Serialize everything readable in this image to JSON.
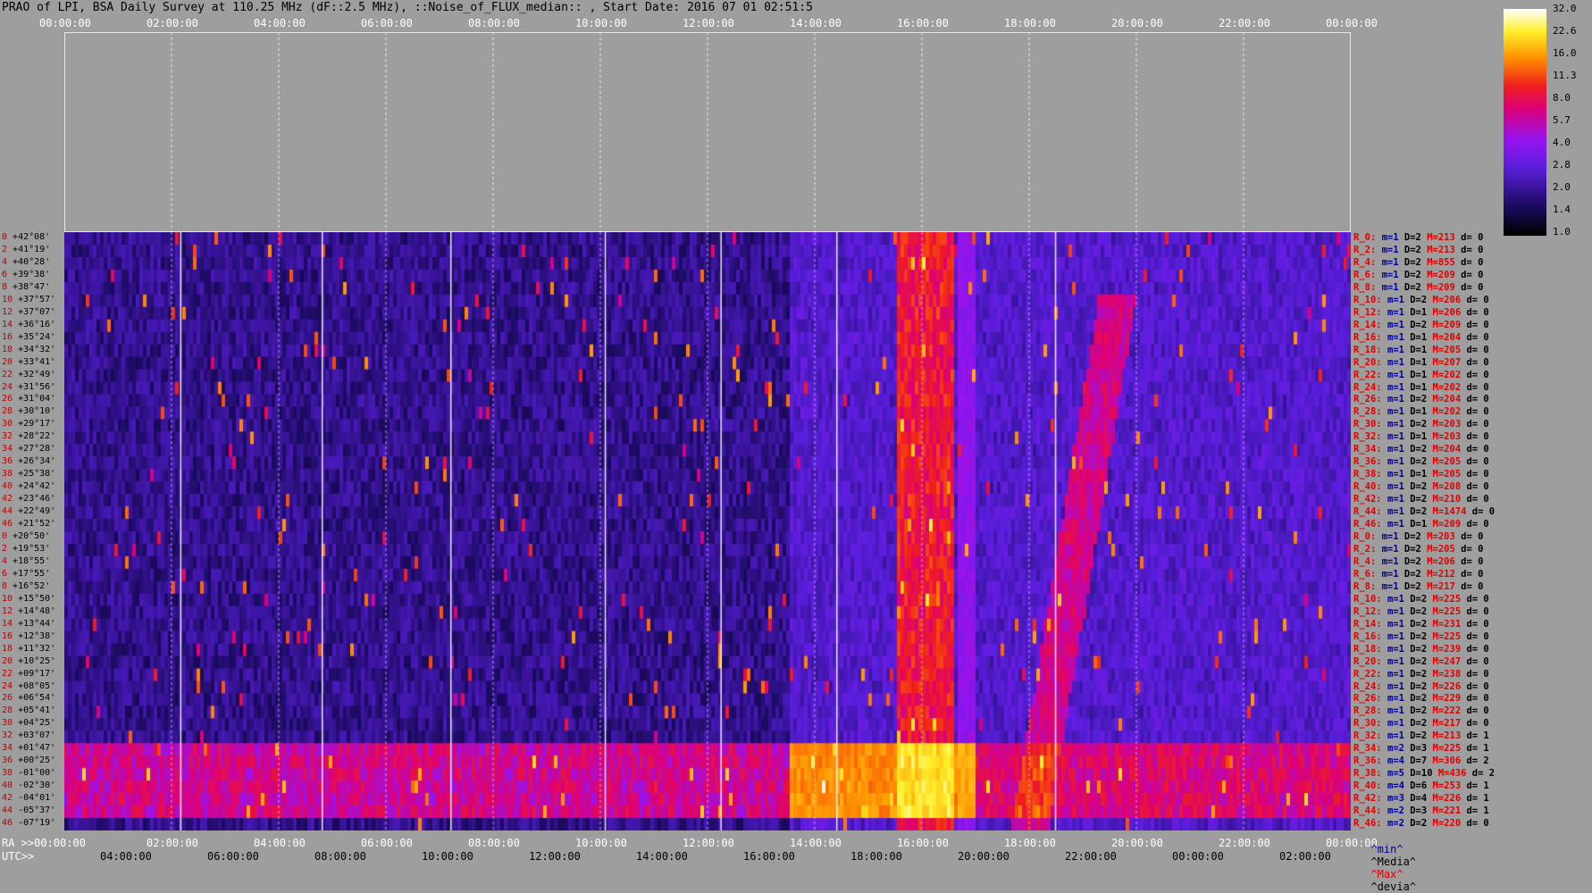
{
  "title": "PRAO of LPI, BSA Daily Survey at 110.25 MHz (dF::2.5 MHz), ::Noise_of_FLUX_median:: , Start Date: 2016 07 01 02:51:5",
  "axis": {
    "top_ticks": [
      "00:00:00",
      "02:00:00",
      "04:00:00",
      "06:00:00",
      "08:00:00",
      "10:00:00",
      "12:00:00",
      "14:00:00",
      "16:00:00",
      "18:00:00",
      "20:00:00",
      "22:00:00",
      "00:00:00"
    ],
    "ra_label": "RA >>00:00:00",
    "ra_ticks": [
      "02:00:00",
      "04:00:00",
      "06:00:00",
      "08:00:00",
      "10:00:00",
      "12:00:00",
      "14:00:00",
      "16:00:00",
      "18:00:00",
      "20:00:00",
      "22:00:00",
      "00:00:00"
    ],
    "utc_label": "UTC>>",
    "utc_ticks": [
      "04:00:00",
      "06:00:00",
      "08:00:00",
      "10:00:00",
      "12:00:00",
      "14:00:00",
      "16:00:00",
      "18:00:00",
      "20:00:00",
      "22:00:00",
      "00:00:00",
      "02:00:00"
    ]
  },
  "colorbar": {
    "ticks": [
      "32.0",
      "22.6",
      "16.0",
      "11.3",
      "8.0",
      "5.7",
      "4.0",
      "2.8",
      "2.0",
      "1.4",
      "1.0"
    ]
  },
  "legend": {
    "min": "^min^",
    "media": "^Media^",
    "max": "^Max^",
    "devia": "^devia^"
  },
  "chart_data": {
    "type": "heatmap",
    "title": "PRAO of LPI, BSA Daily Survey at 110.25 MHz (dF::2.5 MHz), ::Noise_of_FLUX_median:: , Start Date: 2016 07 01 02:51:5",
    "xlabel": "RA / UTC",
    "x_range_hours": [
      0,
      24
    ],
    "colorscale_range": [
      1.0,
      32.0
    ],
    "colorscale_log": true,
    "grid": true,
    "declinations": [
      "+42°08'",
      "+41°19'",
      "+40°28'",
      "+39°38'",
      "+38°47'",
      "+37°57'",
      "+37°07'",
      "+36°16'",
      "+35°24'",
      "+34°32'",
      "+33°41'",
      "+32°49'",
      "+31°56'",
      "+31°04'",
      "+30°10'",
      "+29°17'",
      "+28°22'",
      "+27°28'",
      "+26°34'",
      "+25°38'",
      "+24°42'",
      "+23°46'",
      "+22°49'",
      "+21°52'",
      "+20°50'",
      "+19°53'",
      "+18°55'",
      "+17°55'",
      "+16°52'",
      "+15°50'",
      "+14°48'",
      "+13°44'",
      "+12°38'",
      "+11°32'",
      "+10°25'",
      "+09°17'",
      "+08°05'",
      "+06°54'",
      "+05°41'",
      "+04°25'",
      "+03°07'",
      "+01°47'",
      "+00°25'",
      "-01°00'",
      "-02°30'",
      "-04°01'",
      "-05°37'",
      "-07°19'"
    ],
    "row_indices": [
      "0",
      "2",
      "4",
      "6",
      "8",
      "10",
      "12",
      "14",
      "16",
      "18",
      "20",
      "22",
      "24",
      "26",
      "28",
      "30",
      "32",
      "34",
      "36",
      "38",
      "40",
      "42",
      "44",
      "46",
      "0",
      "2",
      "4",
      "6",
      "8",
      "10",
      "12",
      "14",
      "16",
      "18",
      "20",
      "22",
      "24",
      "26",
      "28",
      "30",
      "32",
      "34",
      "36",
      "38",
      "40",
      "42",
      "44",
      "46"
    ],
    "row_stats": [
      {
        "r": "R_0:",
        "m": "m=1",
        "D": "D=2",
        "M": "M=213",
        "d": "d= 0"
      },
      {
        "r": "R_2:",
        "m": "m=1",
        "D": "D=2",
        "M": "M=213",
        "d": "d= 0"
      },
      {
        "r": "R_4:",
        "m": "m=1",
        "D": "D=2",
        "M": "M=855",
        "d": "d= 0"
      },
      {
        "r": "R_6:",
        "m": "m=1",
        "D": "D=2",
        "M": "M=209",
        "d": "d= 0"
      },
      {
        "r": "R_8:",
        "m": "m=1",
        "D": "D=2",
        "M": "M=209",
        "d": "d= 0"
      },
      {
        "r": "R_10:",
        "m": "m=1",
        "D": "D=2",
        "M": "M=206",
        "d": "d= 0"
      },
      {
        "r": "R_12:",
        "m": "m=1",
        "D": "D=1",
        "M": "M=206",
        "d": "d= 0"
      },
      {
        "r": "R_14:",
        "m": "m=1",
        "D": "D=2",
        "M": "M=209",
        "d": "d= 0"
      },
      {
        "r": "R_16:",
        "m": "m=1",
        "D": "D=1",
        "M": "M=204",
        "d": "d= 0"
      },
      {
        "r": "R_18:",
        "m": "m=1",
        "D": "D=1",
        "M": "M=205",
        "d": "d= 0"
      },
      {
        "r": "R_20:",
        "m": "m=1",
        "D": "D=1",
        "M": "M=207",
        "d": "d= 0"
      },
      {
        "r": "R_22:",
        "m": "m=1",
        "D": "D=1",
        "M": "M=202",
        "d": "d= 0"
      },
      {
        "r": "R_24:",
        "m": "m=1",
        "D": "D=1",
        "M": "M=202",
        "d": "d= 0"
      },
      {
        "r": "R_26:",
        "m": "m=1",
        "D": "D=2",
        "M": "M=204",
        "d": "d= 0"
      },
      {
        "r": "R_28:",
        "m": "m=1",
        "D": "D=1",
        "M": "M=202",
        "d": "d= 0"
      },
      {
        "r": "R_30:",
        "m": "m=1",
        "D": "D=2",
        "M": "M=203",
        "d": "d= 0"
      },
      {
        "r": "R_32:",
        "m": "m=1",
        "D": "D=1",
        "M": "M=203",
        "d": "d= 0"
      },
      {
        "r": "R_34:",
        "m": "m=1",
        "D": "D=2",
        "M": "M=204",
        "d": "d= 0"
      },
      {
        "r": "R_36:",
        "m": "m=1",
        "D": "D=2",
        "M": "M=205",
        "d": "d= 0"
      },
      {
        "r": "R_38:",
        "m": "m=1",
        "D": "D=1",
        "M": "M=205",
        "d": "d= 0"
      },
      {
        "r": "R_40:",
        "m": "m=1",
        "D": "D=2",
        "M": "M=208",
        "d": "d= 0"
      },
      {
        "r": "R_42:",
        "m": "m=1",
        "D": "D=2",
        "M": "M=210",
        "d": "d= 0"
      },
      {
        "r": "R_44:",
        "m": "m=1",
        "D": "D=2",
        "M": "M=1474",
        "d": "d= 0"
      },
      {
        "r": "R_46:",
        "m": "m=1",
        "D": "D=1",
        "M": "M=209",
        "d": "d= 0"
      },
      {
        "r": "R_0:",
        "m": "m=1",
        "D": "D=2",
        "M": "M=203",
        "d": "d= 0"
      },
      {
        "r": "R_2:",
        "m": "m=1",
        "D": "D=2",
        "M": "M=205",
        "d": "d= 0"
      },
      {
        "r": "R_4:",
        "m": "m=1",
        "D": "D=2",
        "M": "M=206",
        "d": "d= 0"
      },
      {
        "r": "R_6:",
        "m": "m=1",
        "D": "D=2",
        "M": "M=212",
        "d": "d= 0"
      },
      {
        "r": "R_8:",
        "m": "m=1",
        "D": "D=2",
        "M": "M=217",
        "d": "d= 0"
      },
      {
        "r": "R_10:",
        "m": "m=1",
        "D": "D=2",
        "M": "M=225",
        "d": "d= 0"
      },
      {
        "r": "R_12:",
        "m": "m=1",
        "D": "D=2",
        "M": "M=225",
        "d": "d= 0"
      },
      {
        "r": "R_14:",
        "m": "m=1",
        "D": "D=2",
        "M": "M=231",
        "d": "d= 0"
      },
      {
        "r": "R_16:",
        "m": "m=1",
        "D": "D=2",
        "M": "M=225",
        "d": "d= 0"
      },
      {
        "r": "R_18:",
        "m": "m=1",
        "D": "D=2",
        "M": "M=239",
        "d": "d= 0"
      },
      {
        "r": "R_20:",
        "m": "m=1",
        "D": "D=2",
        "M": "M=247",
        "d": "d= 0"
      },
      {
        "r": "R_22:",
        "m": "m=1",
        "D": "D=2",
        "M": "M=238",
        "d": "d= 0"
      },
      {
        "r": "R_24:",
        "m": "m=1",
        "D": "D=2",
        "M": "M=226",
        "d": "d= 0"
      },
      {
        "r": "R_26:",
        "m": "m=1",
        "D": "D=2",
        "M": "M=229",
        "d": "d= 0"
      },
      {
        "r": "R_28:",
        "m": "m=1",
        "D": "D=2",
        "M": "M=222",
        "d": "d= 0"
      },
      {
        "r": "R_30:",
        "m": "m=1",
        "D": "D=2",
        "M": "M=217",
        "d": "d= 0"
      },
      {
        "r": "R_32:",
        "m": "m=1",
        "D": "D=2",
        "M": "M=213",
        "d": "d= 1"
      },
      {
        "r": "R_34:",
        "m": "m=2",
        "D": "D=3",
        "M": "M=225",
        "d": "d= 1"
      },
      {
        "r": "R_36:",
        "m": "m=4",
        "D": "D=7",
        "M": "M=306",
        "d": "d= 2"
      },
      {
        "r": "R_38:",
        "m": "m=5",
        "D": "D=10",
        "M": "M=436",
        "d": "d= 2"
      },
      {
        "r": "R_40:",
        "m": "m=4",
        "D": "D=6",
        "M": "M=253",
        "d": "d= 1"
      },
      {
        "r": "R_42:",
        "m": "m=3",
        "D": "D=4",
        "M": "M=226",
        "d": "d= 1"
      },
      {
        "r": "R_44:",
        "m": "m=2",
        "D": "D=3",
        "M": "M=221",
        "d": "d= 1"
      },
      {
        "r": "R_46:",
        "m": "m=2",
        "D": "D=2",
        "M": "M=220",
        "d": "d= 0"
      }
    ]
  }
}
